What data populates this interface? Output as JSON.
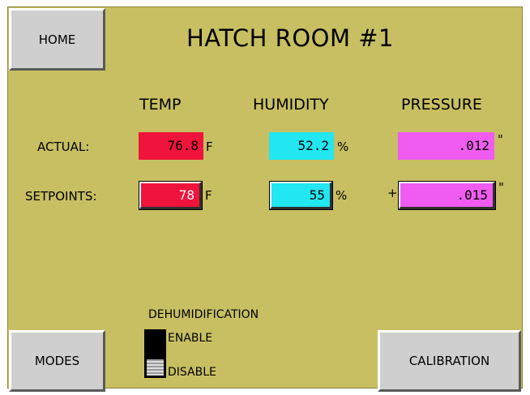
{
  "header": {
    "home_label": "HOME",
    "title": "HATCH ROOM #1"
  },
  "columns": {
    "temp": "TEMP",
    "humidity": "HUMIDITY",
    "pressure": "PRESSURE"
  },
  "rows": {
    "actual_label": "ACTUAL:",
    "setpoints_label": "SETPOINTS:"
  },
  "actual": {
    "temp": "76.8",
    "temp_unit": "F",
    "humidity": "52.2",
    "humidity_unit": "%",
    "pressure": ".012",
    "pressure_unit": "\""
  },
  "setpoints": {
    "temp": "78",
    "temp_unit": "F",
    "humidity": "55",
    "humidity_unit": "%",
    "pressure_sign": "+",
    "pressure": ".015",
    "pressure_unit": "\""
  },
  "dehumidification": {
    "title": "DEHUMIDIFICATION",
    "enable_label": "ENABLE",
    "disable_label": "DISABLE",
    "state": "ENABLE"
  },
  "footer": {
    "modes_label": "MODES",
    "calibration_label": "CALIBRATION"
  },
  "colors": {
    "background": "#c8bf62",
    "temp": "#f0143c",
    "humidity": "#22e6f0",
    "pressure": "#f05cf0"
  }
}
